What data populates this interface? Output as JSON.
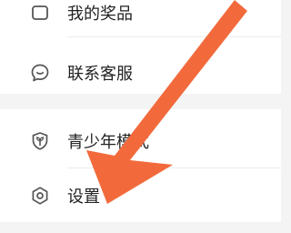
{
  "menu": {
    "items": [
      {
        "id": "my-goods",
        "label": "我的奖品",
        "icon": "box-icon"
      },
      {
        "id": "customer-service",
        "label": "联系客服",
        "icon": "chat-bubble-icon"
      },
      {
        "id": "teen-mode",
        "label": "青少年模式",
        "icon": "shield-sprout-icon"
      },
      {
        "id": "settings",
        "label": "设置",
        "icon": "gear-hexagon-icon"
      }
    ]
  },
  "annotation": {
    "arrow_color": "#f26a3c",
    "icon": "pointer-arrow"
  }
}
